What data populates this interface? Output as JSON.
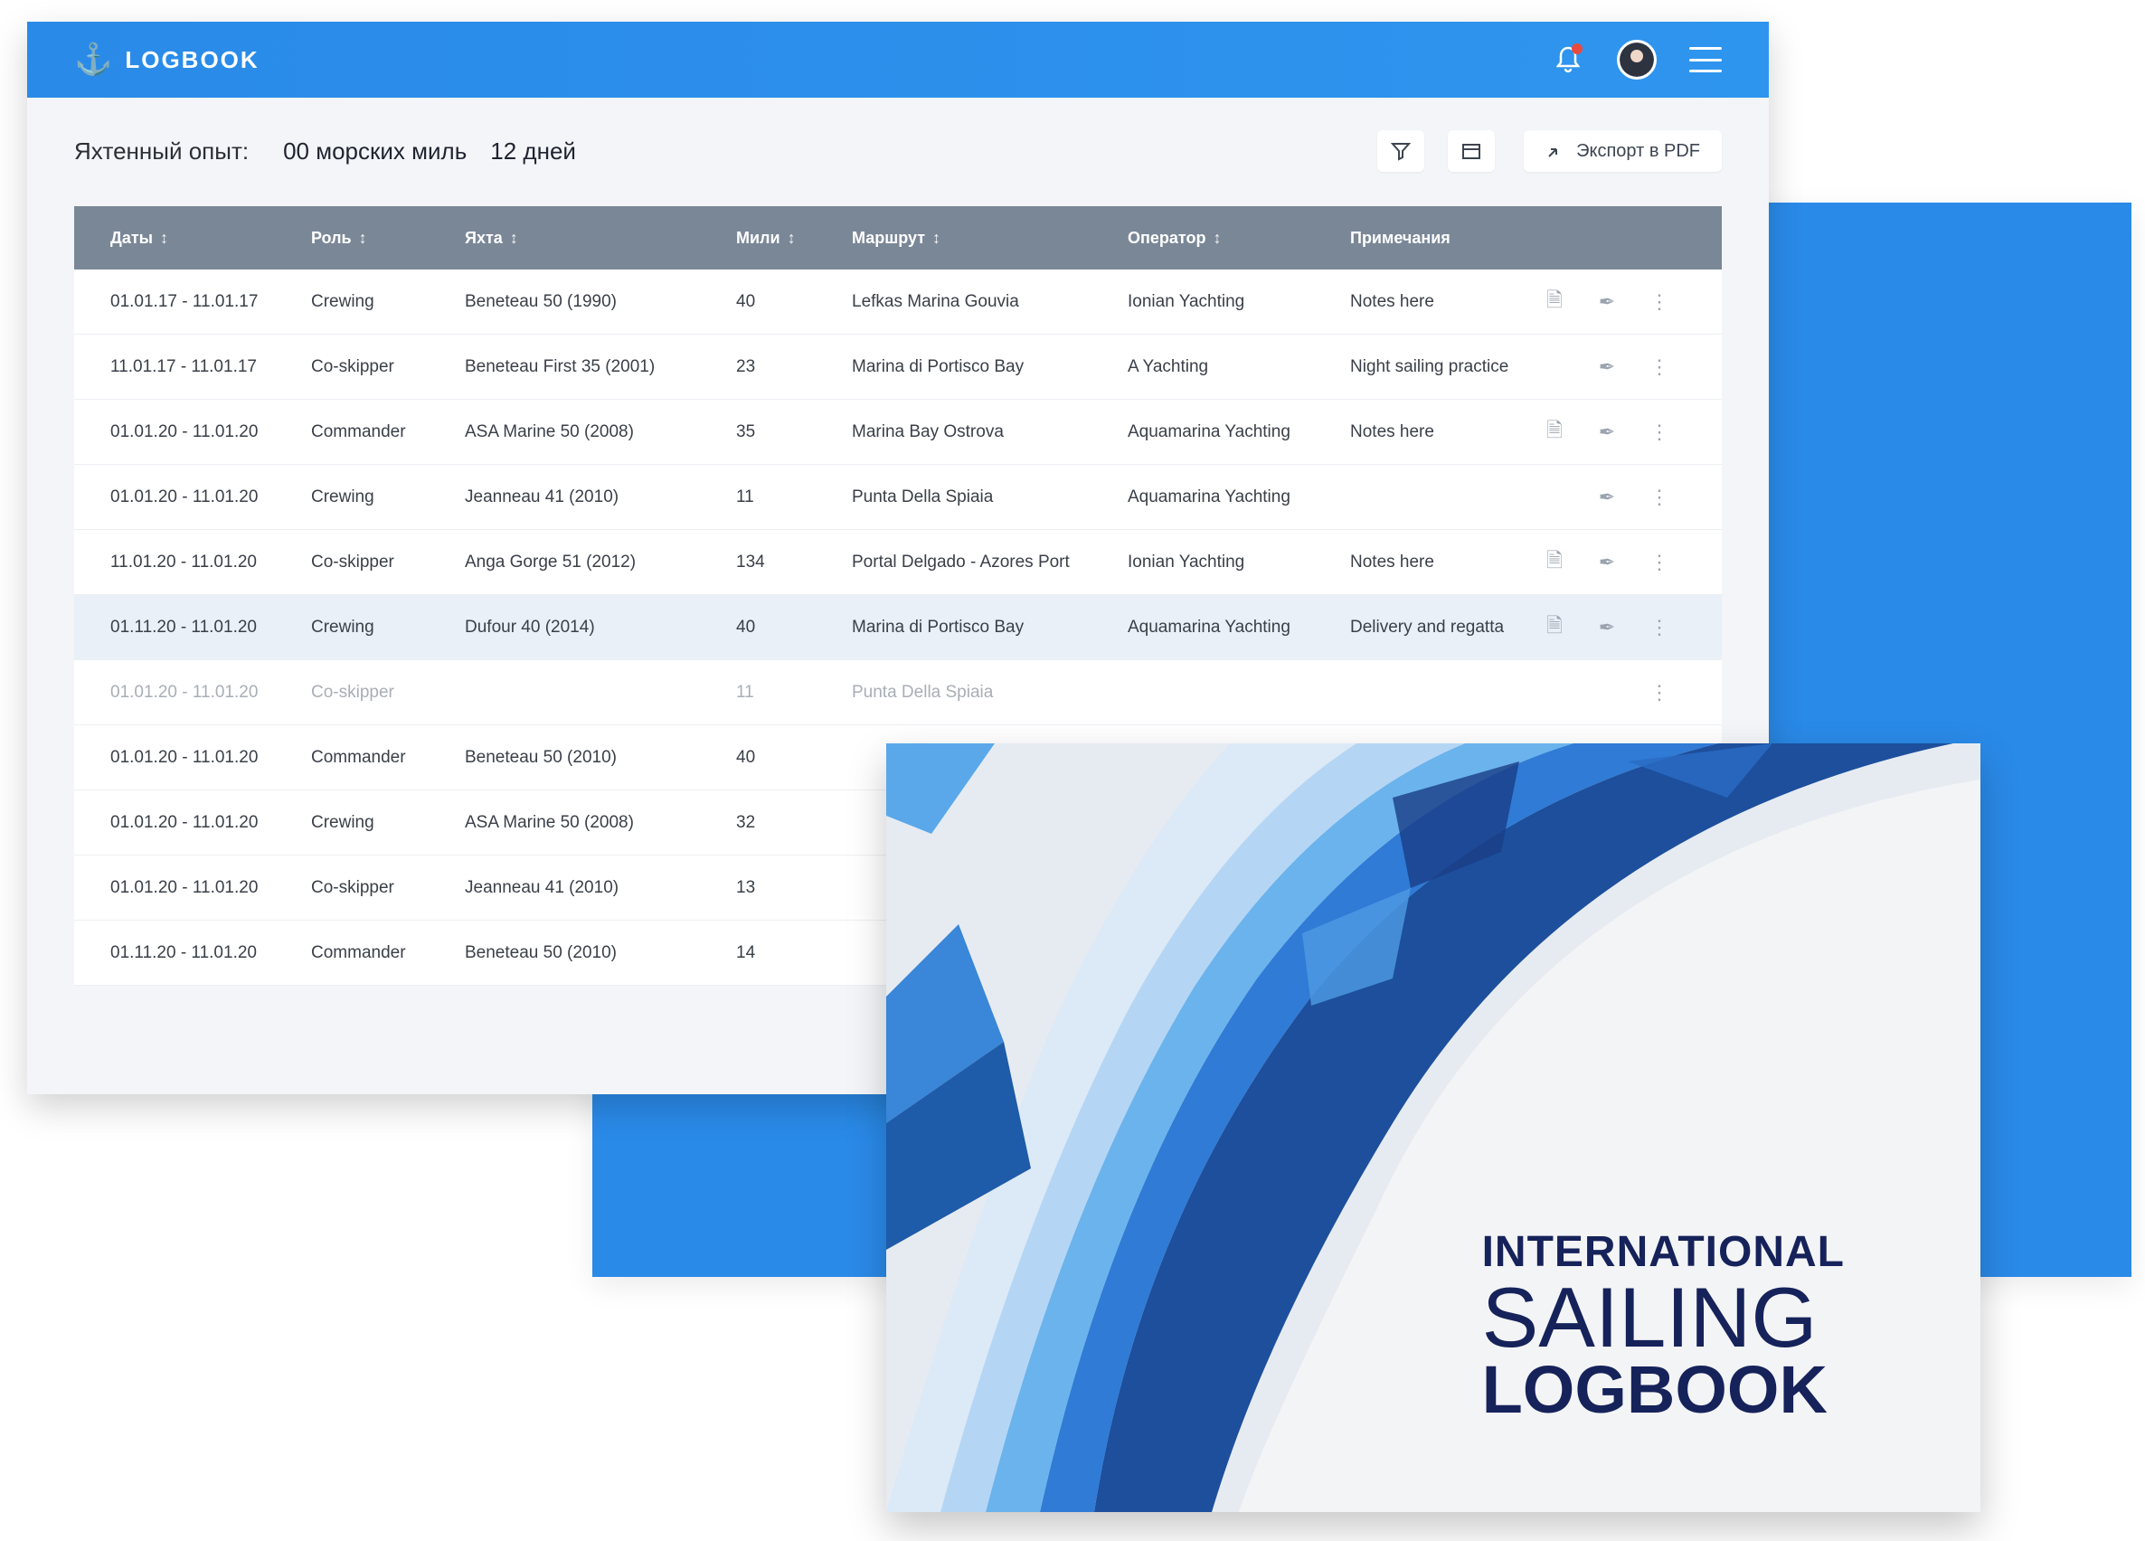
{
  "app": {
    "brand": "LOGBOOK",
    "notifications_count": "1"
  },
  "toolbar": {
    "experience_label": "Яхтенный опыт:",
    "miles": "00 морских миль",
    "days": "12 дней",
    "export_label": "Экспорт в PDF"
  },
  "table": {
    "headers": [
      "Даты",
      "Роль",
      "Яхта",
      "Мили",
      "Маршрут",
      "Оператор",
      "Примечания"
    ],
    "rows": [
      {
        "dates": "01.01.17 - 11.01.17",
        "role": "Crewing",
        "yacht": "Beneteau 50 (1990)",
        "miles": "40",
        "route": "Lefkas Marina Gouvia",
        "operator": "Ionian Yachting",
        "notes": "Notes here",
        "doc": true,
        "selected": false,
        "faded": false
      },
      {
        "dates": "11.01.17 - 11.01.17",
        "role": "Co-skipper",
        "yacht": "Beneteau First 35 (2001)",
        "miles": "23",
        "route": "Marina di Portisco Bay",
        "operator": "A Yachting",
        "notes": "Night sailing practice",
        "doc": false,
        "selected": false,
        "faded": false
      },
      {
        "dates": "01.01.20 - 11.01.20",
        "role": "Commander",
        "yacht": "ASA Marine 50 (2008)",
        "miles": "35",
        "route": "Marina Bay Ostrova",
        "operator": "Aquamarina Yachting",
        "notes": "Notes here",
        "doc": true,
        "selected": false,
        "faded": false
      },
      {
        "dates": "01.01.20 - 11.01.20",
        "role": "Crewing",
        "yacht": "Jeanneau 41 (2010)",
        "miles": "11",
        "route": "Punta Della Spiaia",
        "operator": "Aquamarina Yachting",
        "notes": "",
        "doc": false,
        "selected": false,
        "faded": false
      },
      {
        "dates": "11.01.20 - 11.01.20",
        "role": "Co-skipper",
        "yacht": "Anga Gorge 51 (2012)",
        "miles": "134",
        "route": "Portal Delgado - Azores Port",
        "operator": "Ionian Yachting",
        "notes": "Notes here",
        "doc": true,
        "selected": false,
        "faded": false
      },
      {
        "dates": "01.11.20 - 11.01.20",
        "role": "Crewing",
        "yacht": "Dufour 40 (2014)",
        "miles": "40",
        "route": "Marina di Portisco Bay",
        "operator": "Aquamarina Yachting",
        "notes": "Delivery and regatta",
        "doc": true,
        "selected": true,
        "faded": false
      },
      {
        "dates": "01.01.20 - 11.01.20",
        "role": "Co-skipper",
        "yacht": "",
        "miles": "11",
        "route": "Punta Della Spiaia",
        "operator": "",
        "notes": "",
        "doc": false,
        "selected": false,
        "faded": true
      },
      {
        "dates": "01.01.20 - 11.01.20",
        "role": "Commander",
        "yacht": "Beneteau 50 (2010)",
        "miles": "40",
        "route": "",
        "operator": "",
        "notes": "",
        "doc": false,
        "selected": false,
        "faded": false
      },
      {
        "dates": "01.01.20 - 11.01.20",
        "role": "Crewing",
        "yacht": "ASA Marine 50 (2008)",
        "miles": "32",
        "route": "",
        "operator": "",
        "notes": "",
        "doc": false,
        "selected": false,
        "faded": false
      },
      {
        "dates": "01.01.20 - 11.01.20",
        "role": "Co-skipper",
        "yacht": "Jeanneau 41 (2010)",
        "miles": "13",
        "route": "",
        "operator": "",
        "notes": "",
        "doc": false,
        "selected": false,
        "faded": false
      },
      {
        "dates": "01.11.20 - 11.01.20",
        "role": "Commander",
        "yacht": "Beneteau 50 (2010)",
        "miles": "14",
        "route": "",
        "operator": "",
        "notes": "",
        "doc": false,
        "selected": false,
        "faded": false
      }
    ]
  },
  "book": {
    "line1": "INTERNATIONAL",
    "line2": "SAILING",
    "line3": "LOGBOOK"
  },
  "colors": {
    "accent": "#2a8ae8",
    "header_row": "#7a8797",
    "book_text": "#16225a"
  },
  "icons": {
    "brand": "anchor-icon",
    "notifications": "bell-icon",
    "menu": "hamburger-icon",
    "filter": "filter-icon",
    "calendar": "calendar-icon",
    "export": "pdf-icon",
    "row_doc": "document-icon",
    "row_sign": "signature-icon",
    "row_more": "more-vertical-icon"
  }
}
